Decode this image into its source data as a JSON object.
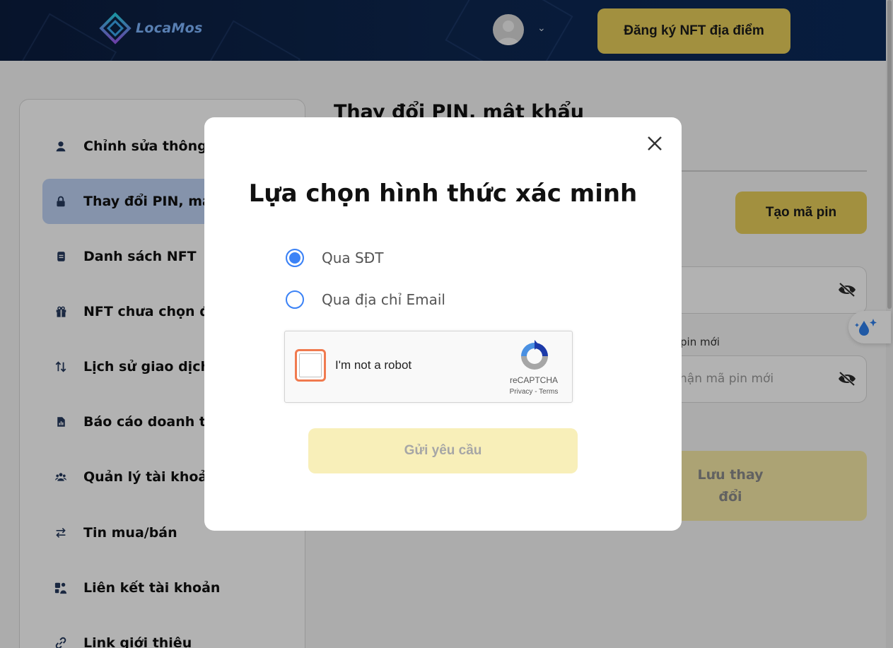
{
  "header": {
    "logo_text": "LocaMos",
    "register_button": "Đăng ký NFT địa điểm",
    "colors": {
      "background": "#0b1d3e",
      "accent": "#e8cf5b"
    }
  },
  "sidebar": {
    "items": [
      {
        "label": "Chỉnh sửa thông ti",
        "icon": "user-icon"
      },
      {
        "label": "Thay đổi PIN, mật ",
        "icon": "lock-icon",
        "active": true
      },
      {
        "label": "Danh sách NFT",
        "icon": "document-icon"
      },
      {
        "label": "NFT chưa chọn địa",
        "icon": "gift-icon"
      },
      {
        "label": "Lịch sử giao dịch",
        "icon": "transfer-icon"
      },
      {
        "label": "Báo cáo doanh thu",
        "icon": "report-icon"
      },
      {
        "label": "Quản lý tài khoản",
        "icon": "users-icon"
      },
      {
        "label": "Tin mua/bán",
        "icon": "swap-icon"
      },
      {
        "label": "Liên kết tài khoản",
        "icon": "link-account-icon"
      },
      {
        "label": "Link giới thiệu",
        "icon": "link-icon"
      }
    ]
  },
  "main": {
    "title": "Thay đổi PIN, mật khẩu",
    "create_pin_button": "Tạo mã pin",
    "new_pin_confirm_label": "pin mới",
    "new_pin_confirm_placeholder": "hận mã pin mới",
    "save_button_line1": "Lưu thay",
    "save_button_line2": "đổi"
  },
  "modal": {
    "title": "Lựa chọn hình thức xác minh",
    "options": [
      {
        "label": "Qua SĐT",
        "checked": true
      },
      {
        "label": "Qua địa chỉ Email",
        "checked": false
      }
    ],
    "recaptcha": {
      "label": "I'm not a robot",
      "brand": "reCAPTCHA",
      "privacy": "Privacy",
      "separator": " - ",
      "terms": "Terms"
    },
    "submit_button": "Gửi yêu cầu"
  }
}
